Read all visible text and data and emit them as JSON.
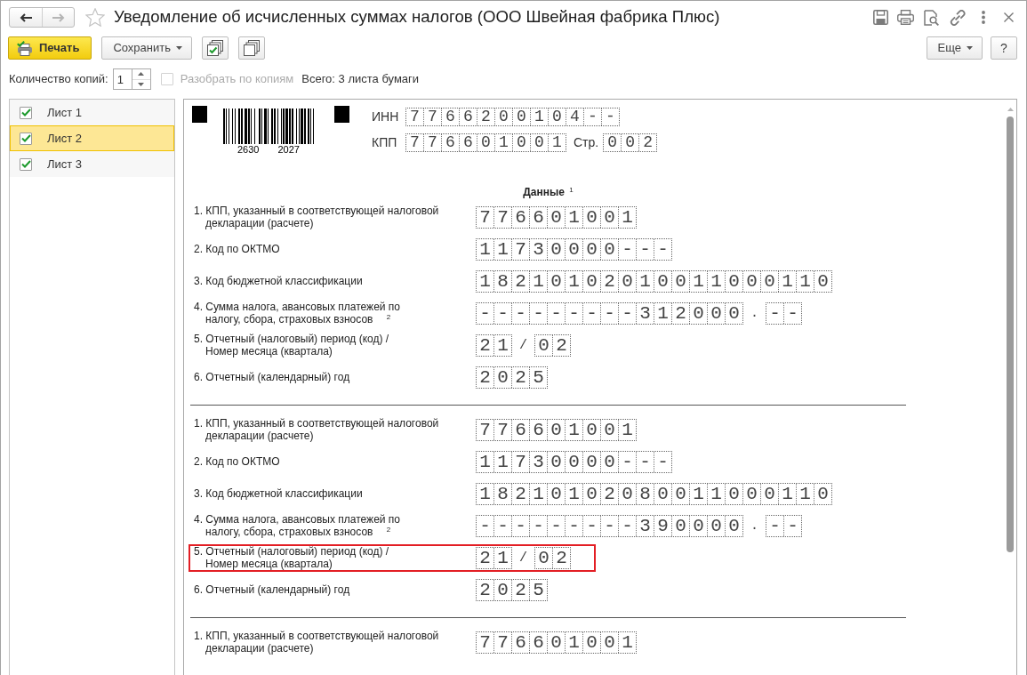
{
  "window": {
    "title": "Уведомление об исчисленных суммах налогов (ООО Швейная фабрика Плюс)"
  },
  "navigation": [
    {
      "kind": "back",
      "disabled": false
    },
    {
      "kind": "forward",
      "disabled": true
    }
  ],
  "toolbar": {
    "left": [
      {
        "kind": "primary",
        "label": "Печать"
      },
      {
        "kind": "dropdown",
        "label": "Сохранить"
      }
    ],
    "right": [
      {
        "kind": "dropdown",
        "label": "Еще"
      },
      {
        "kind": "plain",
        "label": "?"
      }
    ]
  },
  "copies": {
    "label": "Количество копий:",
    "value": "1"
  },
  "collate": {
    "label": "Разобрать по копиям",
    "checked": false,
    "disabled": true
  },
  "total": "Всего: 3 листа бумаги",
  "sheets": [
    {
      "label": "Лист 1",
      "checked": true,
      "selected": false
    },
    {
      "label": "Лист 2",
      "checked": true,
      "selected": true
    },
    {
      "label": "Лист 3",
      "checked": true,
      "selected": false
    }
  ],
  "document": {
    "barcode_numbers": [
      "2630",
      "2027"
    ],
    "inn": {
      "label": "ИНН",
      "cells": [
        "7",
        "7",
        "6",
        "6",
        "2",
        "0",
        "0",
        "1",
        "0",
        "4",
        "-",
        "-"
      ]
    },
    "kpp": {
      "label": "КПП",
      "cells": [
        "7",
        "7",
        "6",
        "6",
        "0",
        "1",
        "0",
        "0",
        "1"
      ]
    },
    "page": {
      "label": "Стр.",
      "cells": [
        "0",
        "0",
        "2"
      ]
    },
    "heading": "Данные $^{1}$",
    "sections": [
      {
        "rows": [
          {
            "label": "1. КПП, указанный в соответствующей налоговой\nдекларации (расчете)",
            "highlighted": false,
            "value": [
              {
                "kind": "cells",
                "chars": [
                  "7",
                  "7",
                  "6",
                  "6",
                  "0",
                  "1",
                  "0",
                  "0",
                  "1"
                ]
              }
            ]
          },
          {
            "label": "2. Код по ОКТМО",
            "highlighted": false,
            "value": [
              {
                "kind": "cells",
                "chars": [
                  "1",
                  "1",
                  "7",
                  "3",
                  "0",
                  "0",
                  "0",
                  "0",
                  "-",
                  "-",
                  "-"
                ]
              }
            ]
          },
          {
            "label": "3. Код бюджетной классификации",
            "highlighted": false,
            "value": [
              {
                "kind": "cells",
                "chars": [
                  "1",
                  "8",
                  "2",
                  "1",
                  "0",
                  "1",
                  "0",
                  "2",
                  "0",
                  "1",
                  "0",
                  "0",
                  "1",
                  "1",
                  "0",
                  "0",
                  "0",
                  "1",
                  "1",
                  "0"
                ]
              }
            ]
          },
          {
            "label": "4. Сумма налога, авансовых платежей по\nналогу, сбора, страховых взносов $^{2}$",
            "highlighted": false,
            "value": [
              {
                "kind": "cells",
                "chars": [
                  "-",
                  "-",
                  "-",
                  "-",
                  "-",
                  "-",
                  "-",
                  "-",
                  "-",
                  "3",
                  "1",
                  "2",
                  "0",
                  "0",
                  "0"
                ]
              },
              {
                "kind": "separator",
                "text": "."
              },
              {
                "kind": "cells",
                "chars": [
                  "-",
                  "-"
                ]
              }
            ]
          },
          {
            "label": "5. Отчетный (налоговый) период (код) /\nНомер месяца (квартала)",
            "highlighted": false,
            "value": [
              {
                "kind": "cells",
                "chars": [
                  "2",
                  "1"
                ]
              },
              {
                "kind": "separator",
                "text": "/"
              },
              {
                "kind": "cells",
                "chars": [
                  "0",
                  "2"
                ]
              }
            ]
          },
          {
            "label": "6. Отчетный (календарный) год",
            "highlighted": false,
            "value": [
              {
                "kind": "cells",
                "chars": [
                  "2",
                  "0",
                  "2",
                  "5"
                ]
              }
            ]
          }
        ]
      },
      {
        "rows": [
          {
            "label": "1. КПП, указанный в соответствующей налоговой\nдекларации (расчете)",
            "highlighted": false,
            "value": [
              {
                "kind": "cells",
                "chars": [
                  "7",
                  "7",
                  "6",
                  "6",
                  "0",
                  "1",
                  "0",
                  "0",
                  "1"
                ]
              }
            ]
          },
          {
            "label": "2. Код по ОКТМО",
            "highlighted": false,
            "value": [
              {
                "kind": "cells",
                "chars": [
                  "1",
                  "1",
                  "7",
                  "3",
                  "0",
                  "0",
                  "0",
                  "0",
                  "-",
                  "-",
                  "-"
                ]
              }
            ]
          },
          {
            "label": "3. Код бюджетной классификации",
            "highlighted": false,
            "value": [
              {
                "kind": "cells",
                "chars": [
                  "1",
                  "8",
                  "2",
                  "1",
                  "0",
                  "1",
                  "0",
                  "2",
                  "0",
                  "8",
                  "0",
                  "0",
                  "1",
                  "1",
                  "0",
                  "0",
                  "0",
                  "1",
                  "1",
                  "0"
                ]
              }
            ]
          },
          {
            "label": "4. Сумма налога, авансовых платежей по\nналогу, сбора, страховых взносов $^{2}$",
            "highlighted": false,
            "value": [
              {
                "kind": "cells",
                "chars": [
                  "-",
                  "-",
                  "-",
                  "-",
                  "-",
                  "-",
                  "-",
                  "-",
                  "-",
                  "3",
                  "9",
                  "0",
                  "0",
                  "0",
                  "0"
                ]
              },
              {
                "kind": "separator",
                "text": "."
              },
              {
                "kind": "cells",
                "chars": [
                  "-",
                  "-"
                ]
              }
            ]
          },
          {
            "label": "5. Отчетный (налоговый) период (код) /\nНомер месяца (квартала)",
            "highlighted": true,
            "value": [
              {
                "kind": "cells",
                "chars": [
                  "2",
                  "1"
                ]
              },
              {
                "kind": "separator",
                "text": "/"
              },
              {
                "kind": "cells",
                "chars": [
                  "0",
                  "2"
                ]
              }
            ]
          },
          {
            "label": "6. Отчетный (календарный) год",
            "highlighted": false,
            "value": [
              {
                "kind": "cells",
                "chars": [
                  "2",
                  "0",
                  "2",
                  "5"
                ]
              }
            ]
          }
        ]
      },
      {
        "rows": [
          {
            "label": "1. КПП, указанный в соответствующей налоговой\nдекларации (расчете)",
            "highlighted": false,
            "value": [
              {
                "kind": "cells",
                "chars": [
                  "7",
                  "7",
                  "6",
                  "6",
                  "0",
                  "1",
                  "0",
                  "0",
                  "1"
                ]
              }
            ]
          }
        ]
      }
    ]
  }
}
